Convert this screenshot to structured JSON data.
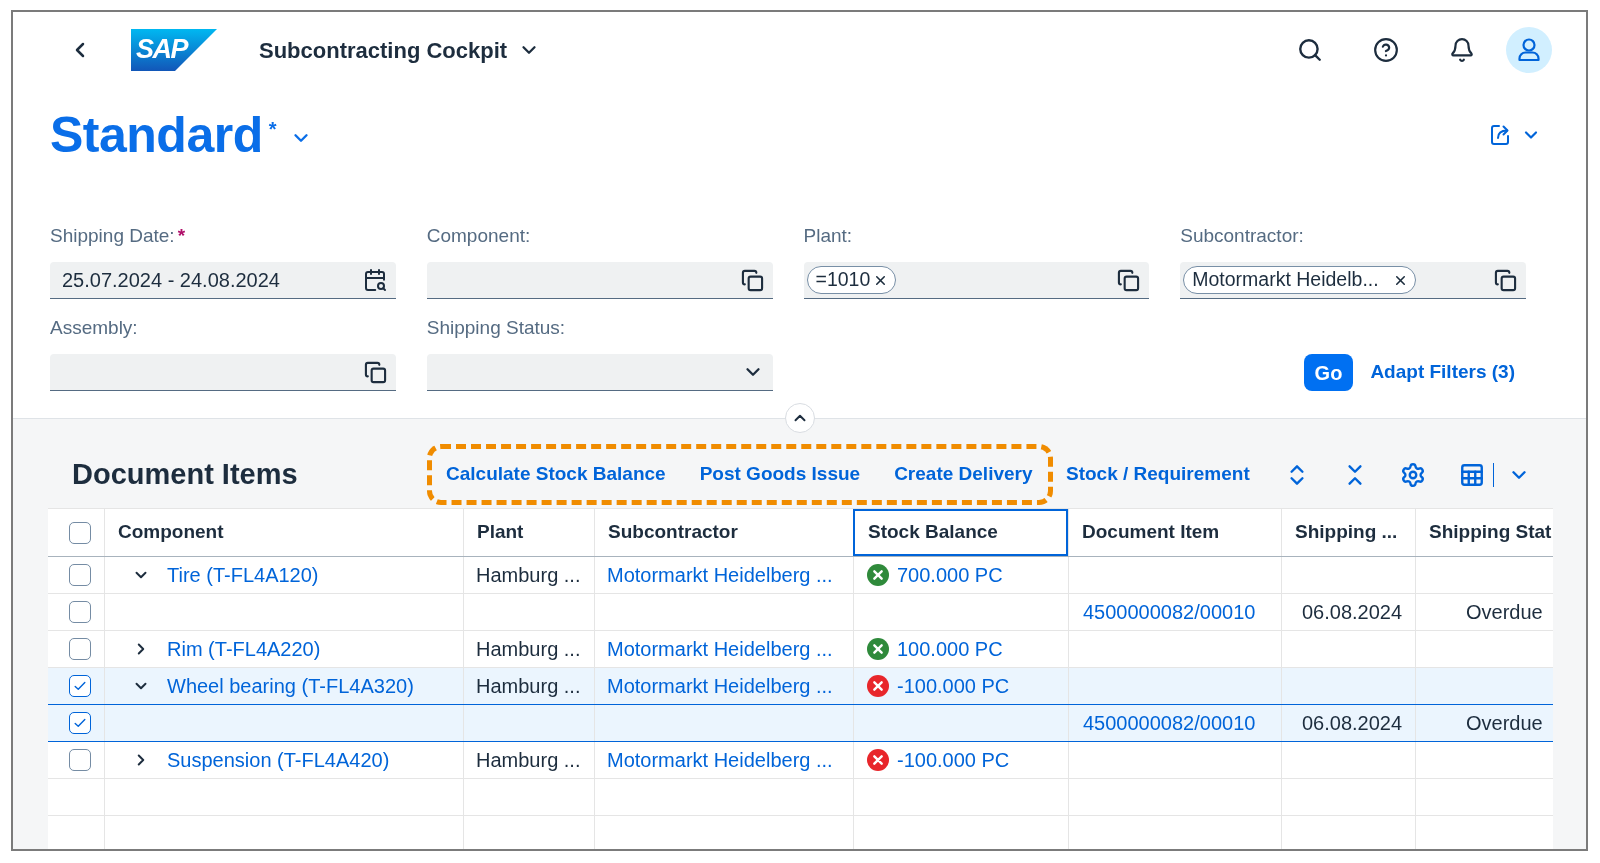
{
  "shell": {
    "logo": "SAP",
    "title": "Subcontracting Cockpit"
  },
  "header": {
    "variant": "Standard",
    "modified_mark": "*"
  },
  "filters": [
    {
      "label": "Shipping Date:",
      "required_mark": "*",
      "kind": "date",
      "value": "25.07.2024 - 24.08.2024"
    },
    {
      "label": "Component:",
      "kind": "value_help"
    },
    {
      "label": "Plant:",
      "kind": "value_help",
      "tokens": [
        "=1010"
      ]
    },
    {
      "label": "Subcontractor:",
      "kind": "value_help",
      "tokens": [
        "Motormarkt Heidelb..."
      ]
    },
    {
      "label": "Assembly:",
      "kind": "value_help"
    },
    {
      "label": "Shipping Status:",
      "kind": "dropdown"
    }
  ],
  "filter_actions": {
    "go": "Go",
    "adapt_filters": "Adapt Filters (3)"
  },
  "table": {
    "title": "Document Items",
    "highlighted_actions": [
      "Calculate Stock Balance",
      "Post Goods Issue",
      "Create Delivery"
    ],
    "actions": [
      "Stock / Requirement"
    ],
    "select_all": {
      "checked": false
    },
    "columns": [
      {
        "label": "Component",
        "focused": false
      },
      {
        "label": "Plant",
        "focused": false
      },
      {
        "label": "Subcontractor",
        "focused": false
      },
      {
        "label": "Stock Balance",
        "focused": true
      },
      {
        "label": "Document Item",
        "focused": false
      },
      {
        "label": "Shipping ...",
        "focused": false
      },
      {
        "label": "Shipping Stat",
        "focused": false
      }
    ],
    "rows": [
      {
        "selected": false,
        "expanded": true,
        "component": "Tire (T-FL4A120)",
        "plant": "Hamburg ...",
        "subcontractor": "Motormarkt Heidelberg ...",
        "stock_balance": {
          "text": "700.000 PC",
          "color": "#2f8a3b"
        },
        "children": [
          {
            "selected": false,
            "document_item": "4500000082/00010",
            "shipping_date": "06.08.2024",
            "shipping_status": "Overdue"
          }
        ]
      },
      {
        "selected": false,
        "expanded": false,
        "component": "Rim (T-FL4A220)",
        "plant": "Hamburg ...",
        "subcontractor": "Motormarkt Heidelberg ...",
        "stock_balance": {
          "text": "100.000 PC",
          "color": "#2f8a3b"
        }
      },
      {
        "selected": true,
        "expanded": true,
        "component": "Wheel bearing (T-FL4A320)",
        "plant": "Hamburg ...",
        "subcontractor": "Motormarkt Heidelberg ...",
        "stock_balance": {
          "text": "-100.000 PC",
          "color": "#e8262b"
        },
        "children": [
          {
            "selected": true,
            "document_item": "4500000082/00010",
            "shipping_date": "06.08.2024",
            "shipping_status": "Overdue"
          }
        ]
      },
      {
        "selected": false,
        "expanded": false,
        "component": "Suspension (T-FL4A420)",
        "plant": "Hamburg ...",
        "subcontractor": "Motormarkt Heidelberg ...",
        "stock_balance": {
          "text": "-100.000 PC",
          "color": "#e8262b"
        }
      }
    ]
  }
}
